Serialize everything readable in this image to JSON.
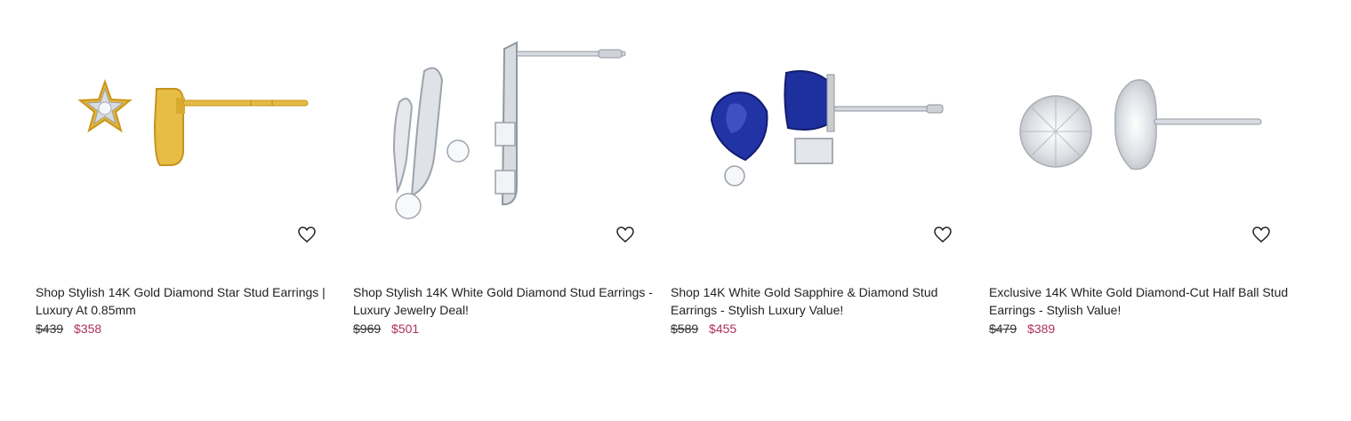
{
  "products": [
    {
      "title": "Shop Stylish 14K Gold Diamond Star Stud Earrings | Luxury At 0.85mm",
      "old_price": "$439",
      "price": "$358",
      "image_icon": "gold-star-stud-earring-image",
      "wishlist_icon": "heart-icon"
    },
    {
      "title": "Shop Stylish 14K White Gold Diamond Stud Earrings - Luxury Jewelry Deal!",
      "old_price": "$969",
      "price": "$501",
      "image_icon": "white-gold-diamond-earring-image",
      "wishlist_icon": "heart-icon"
    },
    {
      "title": "Shop 14K White Gold Sapphire & Diamond Stud Earrings - Stylish Luxury Value!",
      "old_price": "$589",
      "price": "$455",
      "image_icon": "sapphire-diamond-stud-earring-image",
      "wishlist_icon": "heart-icon"
    },
    {
      "title": "Exclusive 14K White Gold Diamond-Cut Half Ball Stud Earrings - Stylish Value!",
      "old_price": "$479",
      "price": "$389",
      "image_icon": "half-ball-stud-earring-image",
      "wishlist_icon": "heart-icon"
    }
  ],
  "colors": {
    "sale_price": "#b0305a",
    "text": "#222222",
    "gold": "#e0b232",
    "white_gold": "#c9cdd2",
    "sapphire": "#1f2f9e"
  }
}
